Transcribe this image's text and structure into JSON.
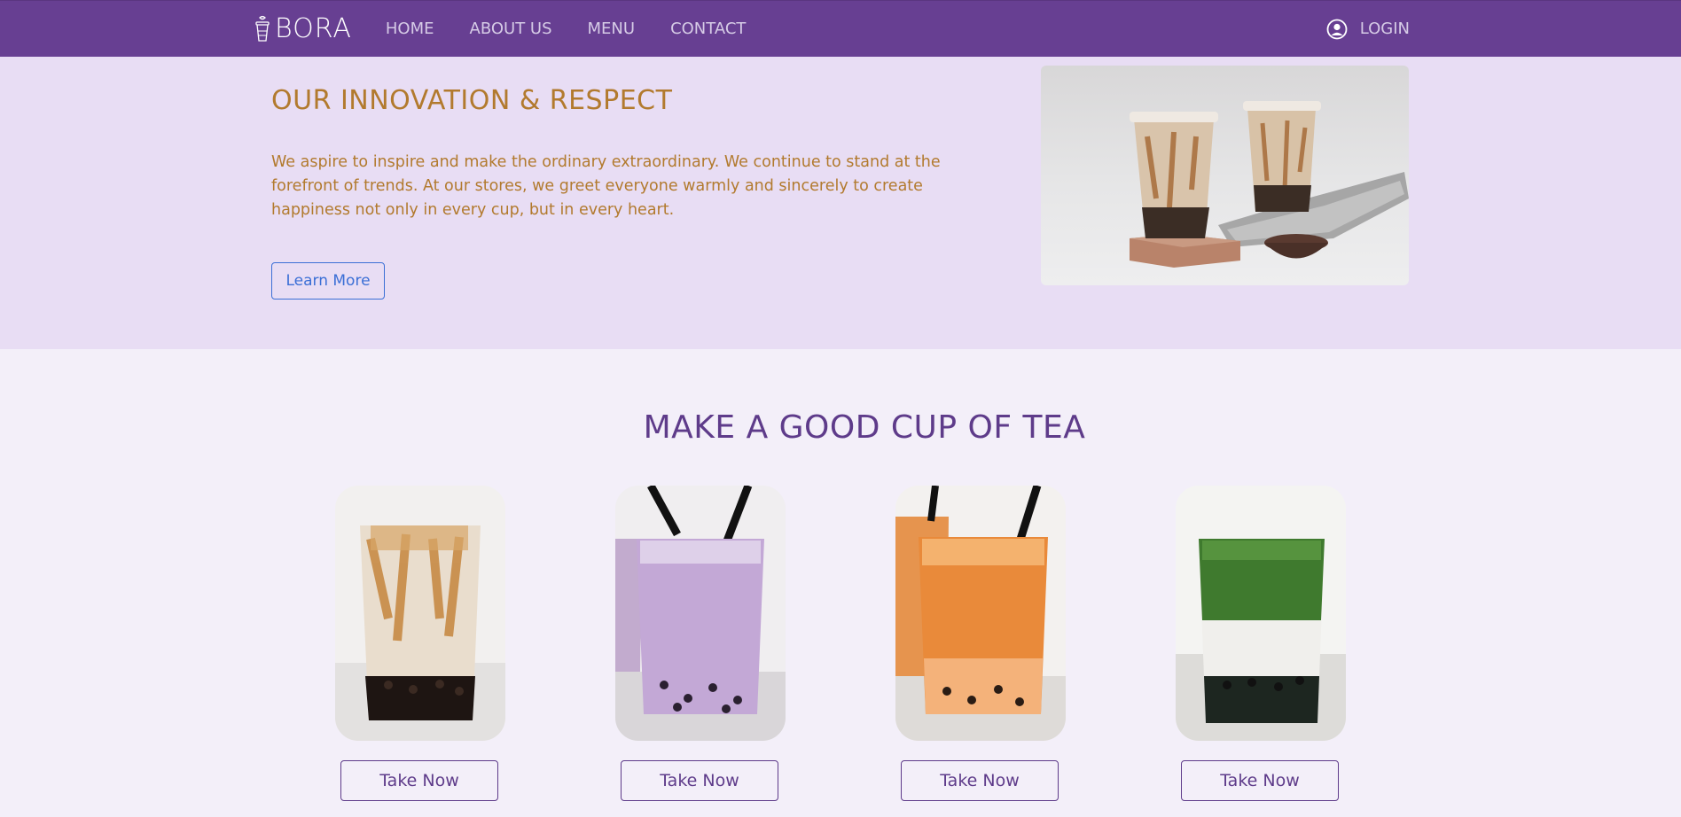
{
  "nav": {
    "logo_text": "BORA",
    "links": [
      "HOME",
      "ABOUT US",
      "MENU",
      "CONTACT"
    ],
    "login_label": "LOGIN"
  },
  "hero": {
    "title": "OUR INNOVATION & RESPECT",
    "text": "We aspire to inspire and make the ordinary extraordinary. We continue to stand at the forefront of trends. At our stores, we greet everyone warmly and sincerely to create happiness not only in every cup, but in every heart.",
    "button_label": "Learn More"
  },
  "section": {
    "title": "MAKE A GOOD CUP OF TEA",
    "cards": [
      {
        "button_label": "Take Now"
      },
      {
        "button_label": "Take Now"
      },
      {
        "button_label": "Take Now"
      },
      {
        "button_label": "Take Now"
      }
    ]
  },
  "colors": {
    "navbar": "#673f92",
    "hero_bg": "#e8ddf4",
    "page_bg": "#f3eff9",
    "accent_gold": "#b27a2e",
    "accent_purple": "#5e3b8a",
    "link_blue": "#3b6fd6"
  }
}
